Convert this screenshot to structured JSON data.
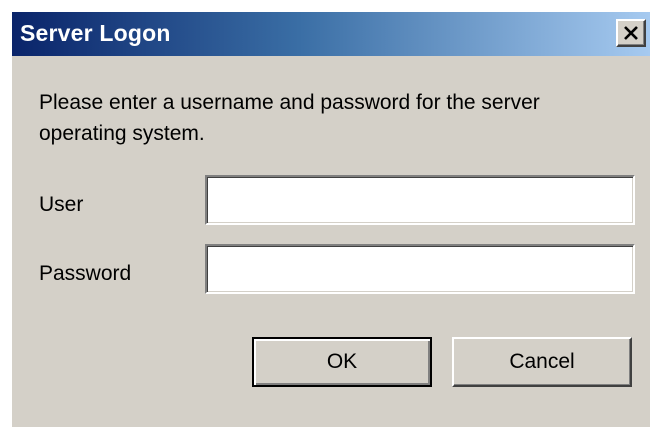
{
  "window": {
    "title": "Server Logon",
    "close_icon": "close-x-icon"
  },
  "message": "Please enter a username and password for the server operating system.",
  "form": {
    "user_label": "User",
    "user_value": "",
    "password_label": "Password",
    "password_value": ""
  },
  "buttons": {
    "ok_label": "OK",
    "cancel_label": "Cancel"
  },
  "colors": {
    "dialog_bg": "#d4d0c8",
    "title_start": "#0a246a",
    "title_end": "#a6caf0",
    "title_text": "#ffffff"
  }
}
